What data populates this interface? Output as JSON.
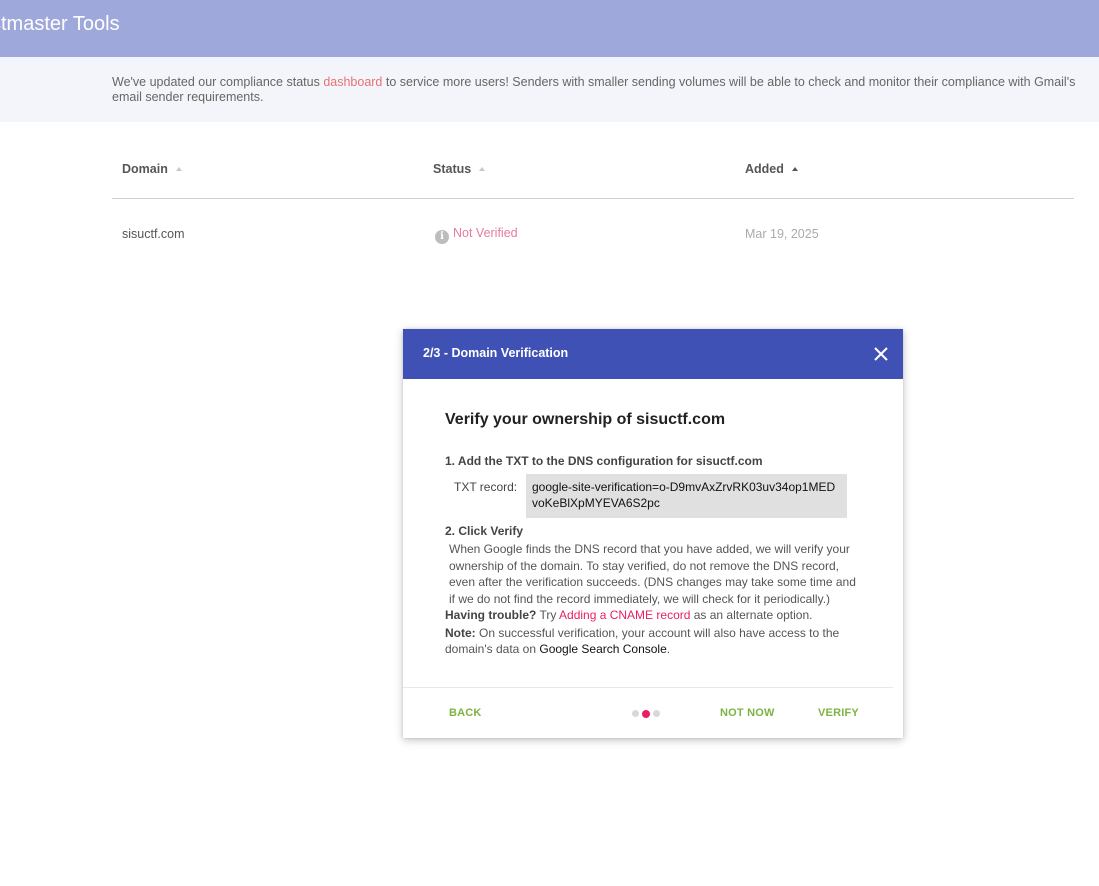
{
  "app": {
    "title": "stmaster Tools"
  },
  "banner": {
    "text_before": "We've updated our compliance status ",
    "link": "dashboard",
    "text_after": " to service more users! Senders with smaller sending volumes will be able to check and monitor their compliance with Gmail's email sender requirements."
  },
  "table": {
    "columns": [
      "Domain",
      "Status",
      "Added"
    ],
    "rows": [
      {
        "domain": "sisuctf.com",
        "status": "Not Verified",
        "added": "Mar 19, 2025"
      }
    ]
  },
  "dialog": {
    "title": "2/3 - Domain Verification",
    "heading": "Verify your ownership of sisuctf.com",
    "step1": "1. Add the TXT to the DNS configuration for sisuctf.com",
    "txt_label": "TXT record:",
    "txt_value": "google-site-verification=o-D9mvAxZrvRK03uv34op1MEDvoKeBlXpMYEVA6S2pc",
    "step2": "2. Click Verify",
    "step2_desc": "When Google finds the DNS record that you have added, we will verify your ownership of the domain. To stay verified, do not remove the DNS record, even after the verification succeeds. (DNS changes may take some time and if we do not find the record immediately, we will check for it periodically.)",
    "trouble_label": "Having trouble?",
    "trouble_try": " Try ",
    "trouble_link": "Adding a CNAME record",
    "trouble_after": " as an alternate option.",
    "note_label": "Note:",
    "note_text": " On successful verification, your account will also have access to the domain's data on ",
    "note_link": "Google Search Console",
    "note_end": ".",
    "back": "BACK",
    "not_now": "NOT NOW",
    "verify": "VERIFY",
    "step_total": 3,
    "step_current": 2
  },
  "colors": {
    "topbar": "#9fa8da",
    "dialog_header": "#3f51b5",
    "accent_pink": "#e91e63",
    "action_green": "#7cb342"
  }
}
